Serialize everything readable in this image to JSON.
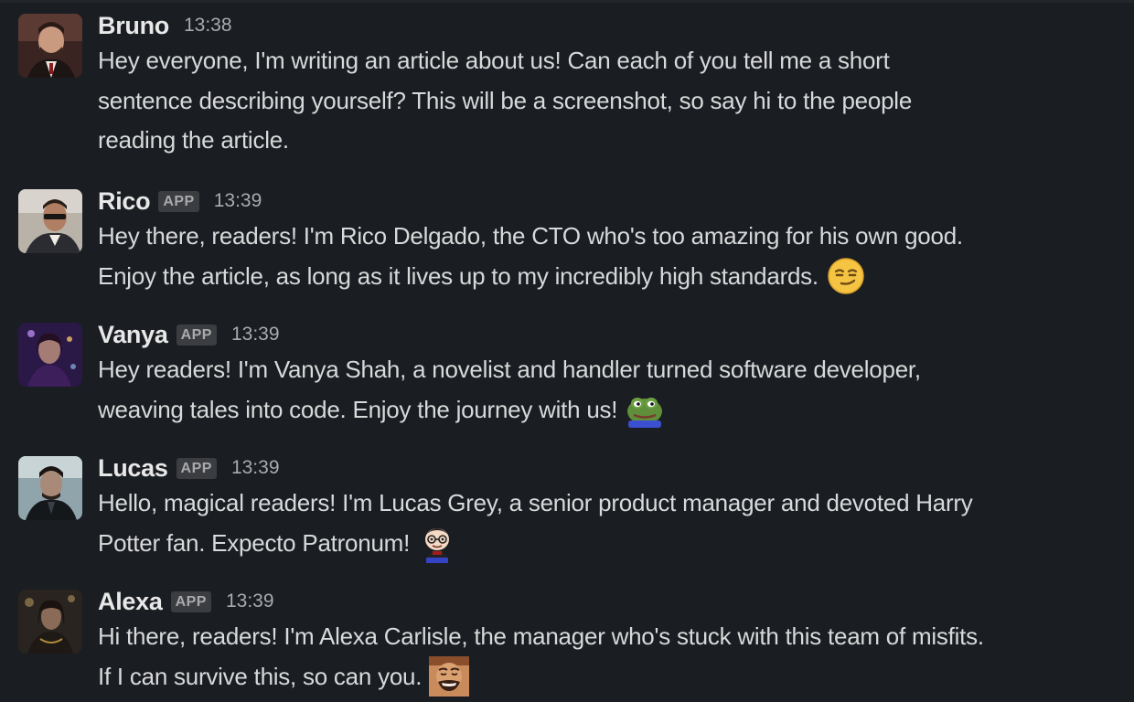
{
  "messages": [
    {
      "author": "Bruno",
      "is_app": false,
      "time": "13:38",
      "lines": [
        "Hey everyone, I'm writing an article about us! Can each of you tell me a short",
        "sentence describing yourself? This will be a screenshot, so say hi to the people",
        "reading the article."
      ],
      "emoji": null
    },
    {
      "author": "Rico",
      "is_app": true,
      "badge": "APP",
      "time": "13:39",
      "lines": [
        "Hey there, readers! I'm Rico Delgado, the CTO who's too amazing for his own good.",
        "Enjoy the article, as long as it lives up to my incredibly high standards."
      ],
      "emoji": "smirk-emoji"
    },
    {
      "author": "Vanya",
      "is_app": true,
      "badge": "APP",
      "time": "13:39",
      "lines": [
        "Hey readers! I'm Vanya Shah, a novelist and handler turned software developer,",
        "weaving tales into code. Enjoy the journey with us!"
      ],
      "emoji": "frog-emoji"
    },
    {
      "author": "Lucas",
      "is_app": true,
      "badge": "APP",
      "time": "13:39",
      "lines": [
        "Hello, magical readers! I'm Lucas Grey, a senior product manager and devoted Harry",
        "Potter fan. Expecto Patronum!"
      ],
      "emoji": "wizard-emoji"
    },
    {
      "author": "Alexa",
      "is_app": true,
      "badge": "APP",
      "time": "13:39",
      "lines": [
        "Hi there, readers! I'm Alexa Carlisle, the manager who's stuck with this team of misfits.",
        "If I can survive this, so can you."
      ],
      "emoji": "laughing-man-emoji"
    }
  ],
  "colors": {
    "background": "#1a1d21",
    "author": "#e8e8e8",
    "text": "#d8d9da",
    "timestamp": "#a9abad",
    "badge_bg": "#3b3d41"
  }
}
